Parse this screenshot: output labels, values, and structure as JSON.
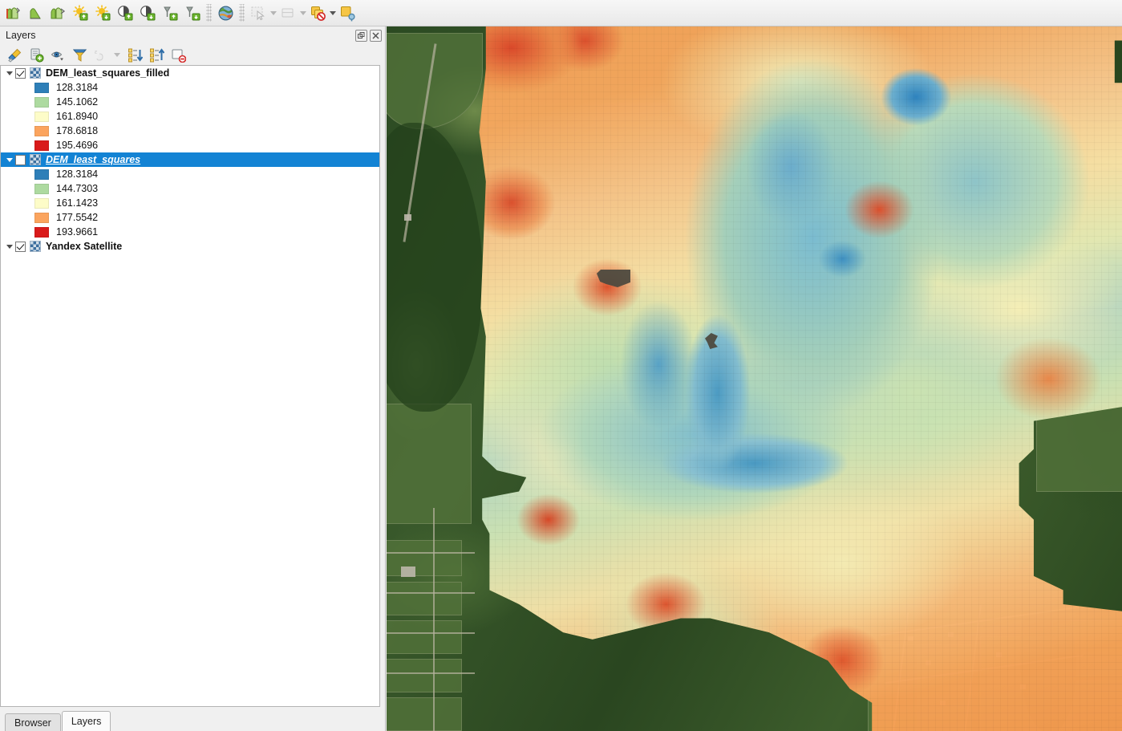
{
  "toolbar": {
    "buttons": [
      {
        "name": "raster-histogram-icon",
        "label": "Raster Histogram",
        "enabled": true
      },
      {
        "name": "raster-profile-icon",
        "label": "Terrain Profile",
        "enabled": true
      },
      {
        "name": "raster-terrain-icon",
        "label": "Terrain Analysis",
        "enabled": true
      },
      {
        "name": "increase-brightness-icon",
        "label": "Increase Brightness",
        "enabled": true
      },
      {
        "name": "decrease-brightness-icon",
        "label": "Decrease Brightness",
        "enabled": true
      },
      {
        "name": "increase-contrast-icon",
        "label": "Increase Contrast",
        "enabled": true
      },
      {
        "name": "decrease-contrast-icon",
        "label": "Decrease Contrast",
        "enabled": true
      },
      {
        "name": "increase-saturation-icon",
        "label": "Increase Saturation",
        "enabled": true
      },
      {
        "name": "decrease-saturation-icon",
        "label": "Decrease Saturation",
        "enabled": true
      },
      {
        "name": "globe-icon",
        "label": "Web / Metasearch",
        "enabled": true
      },
      {
        "name": "select-features-icon",
        "label": "Select Features",
        "enabled": false
      },
      {
        "name": "select-dropdown-icon",
        "label": "Select Tools",
        "enabled": false
      },
      {
        "name": "deselect-features-icon",
        "label": "Deselect Features",
        "enabled": false
      },
      {
        "name": "deselect-dropdown-icon",
        "label": "Deselect Tools",
        "enabled": false
      },
      {
        "name": "identify-deselect-icon",
        "label": "Deselect All Layers",
        "enabled": true
      },
      {
        "name": "identify-dropdown-icon",
        "label": "Identify Tools",
        "enabled": true
      },
      {
        "name": "identify-features-icon",
        "label": "Identify Features",
        "enabled": true
      }
    ]
  },
  "dock": {
    "title": "Layers",
    "float_label": "❐",
    "close_label": "✕",
    "tools": [
      {
        "name": "open-layer-styling-panel-icon",
        "label": "Open the Layer Styling panel",
        "enabled": true
      },
      {
        "name": "add-group-icon",
        "label": "Add Group",
        "enabled": true
      },
      {
        "name": "manage-layer-visibility-icon",
        "label": "Manage Layer Visibility",
        "enabled": true
      },
      {
        "name": "filter-legend-icon",
        "label": "Filter Legend",
        "enabled": true
      },
      {
        "name": "expression-filter-icon",
        "label": "Filter Legend by Expression",
        "enabled": false
      },
      {
        "name": "expression-filter-dropdown-icon",
        "label": "More filter options",
        "enabled": false
      },
      {
        "name": "expand-all-icon",
        "label": "Expand All",
        "enabled": true
      },
      {
        "name": "collapse-all-icon",
        "label": "Collapse All",
        "enabled": true
      },
      {
        "name": "remove-layer-icon",
        "label": "Remove Layer/Group",
        "enabled": true
      }
    ],
    "layers": [
      {
        "name": "DEM_least_squares_filled",
        "checked": true,
        "selected": false,
        "expanded": true,
        "legend": [
          {
            "value": "128.3184",
            "color": "#2e7fb8"
          },
          {
            "value": "145.1062",
            "color": "#addaa0"
          },
          {
            "value": "161.8940",
            "color": "#fdfcc8"
          },
          {
            "value": "178.6818",
            "color": "#fba45e"
          },
          {
            "value": "195.4696",
            "color": "#d91a1a"
          }
        ]
      },
      {
        "name": "DEM_least_squares",
        "checked": false,
        "selected": true,
        "expanded": true,
        "legend": [
          {
            "value": "128.3184",
            "color": "#2e7fb8"
          },
          {
            "value": "144.7303",
            "color": "#addaa0"
          },
          {
            "value": "161.1423",
            "color": "#fdfcc8"
          },
          {
            "value": "177.5542",
            "color": "#fba45e"
          },
          {
            "value": "193.9661",
            "color": "#d91a1a"
          }
        ]
      },
      {
        "name": "Yandex Satellite",
        "checked": true,
        "selected": false,
        "expanded": true,
        "legend": []
      }
    ],
    "tabs": [
      {
        "name": "Browser",
        "active": false
      },
      {
        "name": "Layers",
        "active": true
      }
    ]
  },
  "map": {
    "basemap_label": "Yandex Satellite",
    "raster_label": "DEM_least_squares_filled",
    "colors": {
      "low": "#2e7fb8",
      "mid_low": "#addaa0",
      "mid": "#fdfcc8",
      "mid_high": "#fba45e",
      "high": "#d91a1a",
      "nodata": "#4e4a3f",
      "selection": "#1383d4"
    }
  }
}
